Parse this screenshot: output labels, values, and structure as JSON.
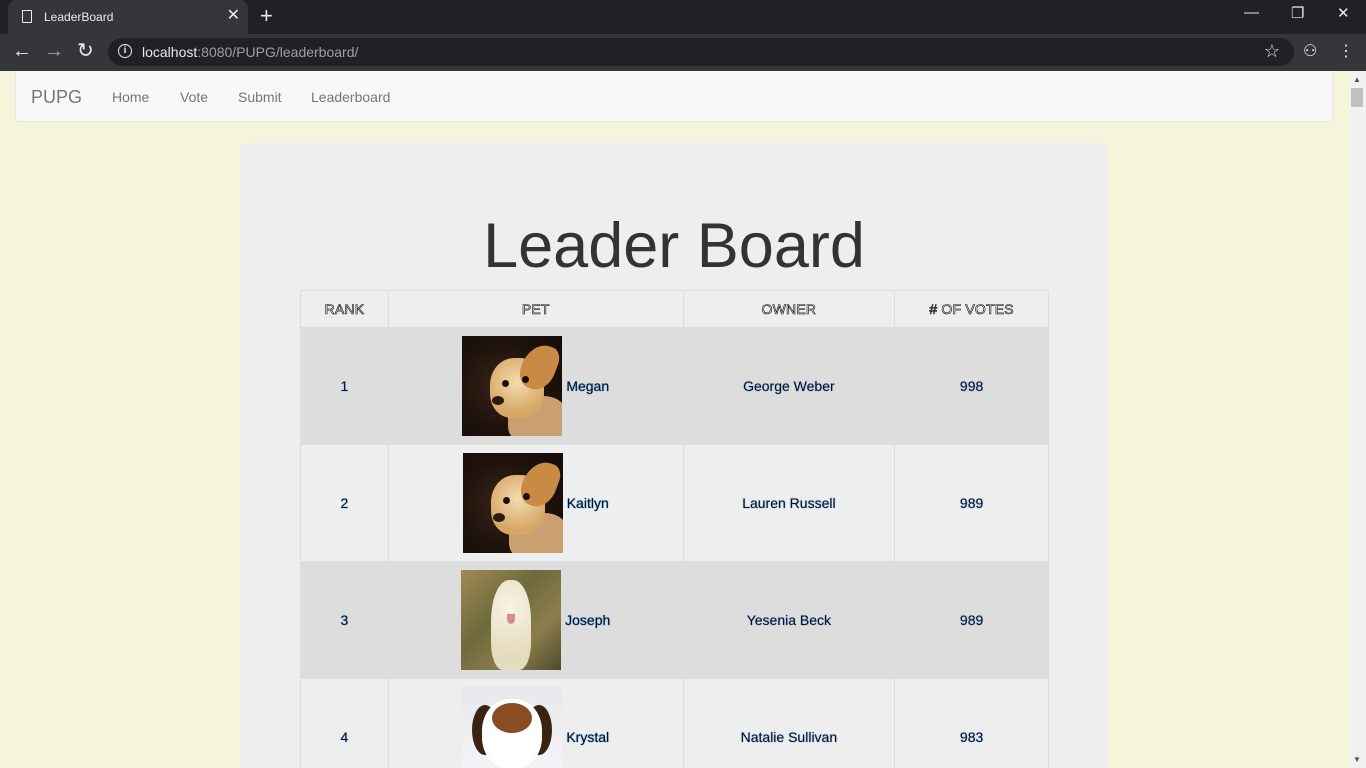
{
  "browser": {
    "tab_title": "LeaderBoard",
    "url_host": "localhost",
    "url_rest": ":8080/PUPG/leaderboard/"
  },
  "navbar": {
    "brand": "PUPG",
    "links": [
      "Home",
      "Vote",
      "Submit",
      "Leaderboard"
    ]
  },
  "page": {
    "heading": "Leader Board"
  },
  "table": {
    "headers": [
      "RANK",
      "PET",
      "OWNER",
      "# OF VOTES"
    ],
    "rows": [
      {
        "rank": "1",
        "pet": "Megan",
        "owner": "George Weber",
        "votes": "998"
      },
      {
        "rank": "2",
        "pet": "Kaitlyn",
        "owner": "Lauren Russell",
        "votes": "989"
      },
      {
        "rank": "3",
        "pet": "Joseph",
        "owner": "Yesenia Beck",
        "votes": "989"
      },
      {
        "rank": "4",
        "pet": "Krystal",
        "owner": "Natalie Sullivan",
        "votes": "983"
      }
    ]
  },
  "colors": {
    "page_bg": "#f5f5dc",
    "jumbotron_bg": "#eeeeee",
    "row_alt_bg": "#dddddd"
  }
}
